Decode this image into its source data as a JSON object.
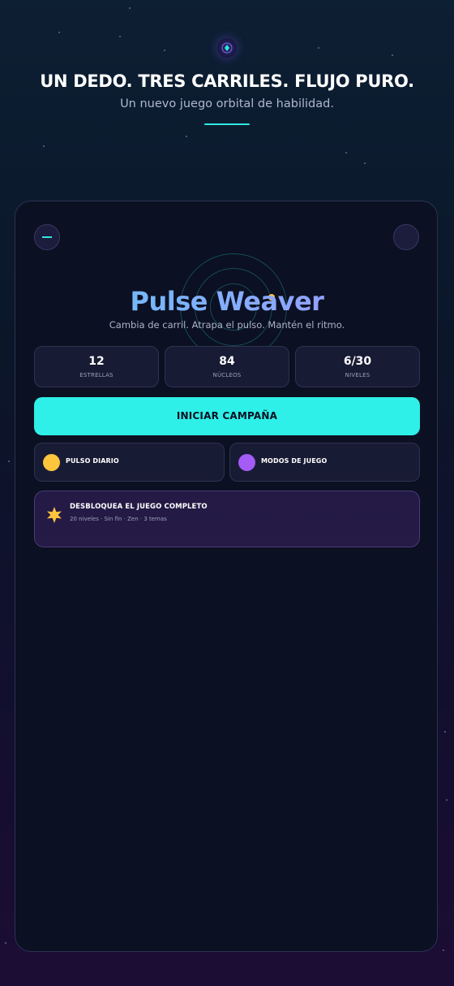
{
  "header": {
    "headline": "UN DEDO. TRES CARRILES. FLUJO PURO.",
    "subheadline": "Un nuevo juego orbital de habilidad.",
    "logo_icon": "orbit-diamond-icon"
  },
  "game": {
    "title": "Pulse Weaver",
    "tagline": "Cambia de carril. Atrapa el pulso. Mantén el ritmo."
  },
  "top_buttons": {
    "left_icon": "menu-icon",
    "right_icon": "profile-icon"
  },
  "stats": [
    {
      "value": "12",
      "label": "ESTRELLAS"
    },
    {
      "value": "84",
      "label": "NÚCLEOS"
    },
    {
      "value": "6/30",
      "label": "NIVELES"
    }
  ],
  "cta": {
    "label": "INICIAR CAMPAÑA"
  },
  "modes": [
    {
      "label": "PULSO DIARIO",
      "icon": "sun-dot-icon",
      "color": "#ffc53d"
    },
    {
      "label": "MODOS DE JUEGO",
      "icon": "planet-dot-icon",
      "color": "#a55bf5"
    }
  ],
  "unlock": {
    "title": "DESBLOQUEA EL JUEGO COMPLETO",
    "subtitle": "20 niveles · Sin fin · Zen · 3 temas",
    "icon": "star-icon",
    "icon_color": "#ffc53d"
  },
  "colors": {
    "accent": "#2ef0e8",
    "card_bg": "#0b1022",
    "page_bg_top": "#0d1f33",
    "page_bg_bottom": "#1c0d34"
  }
}
